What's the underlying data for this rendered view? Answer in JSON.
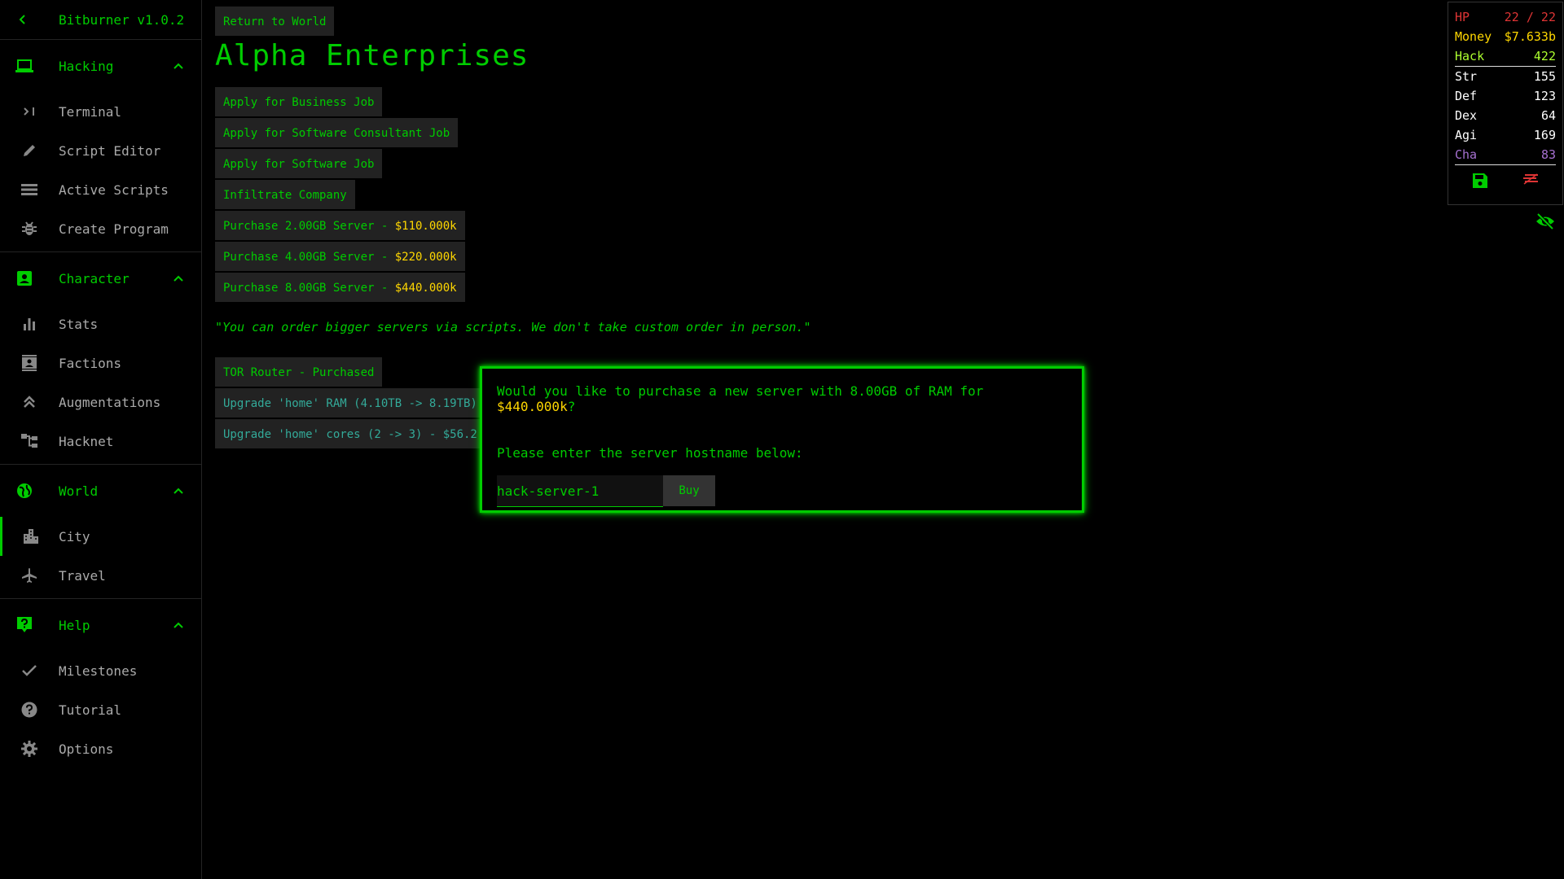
{
  "app": {
    "title": "Bitburner v1.0.2"
  },
  "sidebar": {
    "sections": [
      {
        "label": "Hacking",
        "items": [
          {
            "label": "Terminal",
            "icon": "terminal-icon"
          },
          {
            "label": "Script Editor",
            "icon": "pencil-icon"
          },
          {
            "label": "Active Scripts",
            "icon": "list-icon"
          },
          {
            "label": "Create Program",
            "icon": "bug-icon"
          }
        ]
      },
      {
        "label": "Character",
        "items": [
          {
            "label": "Stats",
            "icon": "bar-chart-icon"
          },
          {
            "label": "Factions",
            "icon": "contacts-icon"
          },
          {
            "label": "Augmentations",
            "icon": "double-chevron-up-icon"
          },
          {
            "label": "Hacknet",
            "icon": "tree-icon"
          }
        ]
      },
      {
        "label": "World",
        "items": [
          {
            "label": "City",
            "icon": "city-icon"
          },
          {
            "label": "Travel",
            "icon": "airplane-icon"
          }
        ]
      },
      {
        "label": "Help",
        "items": [
          {
            "label": "Milestones",
            "icon": "check-icon"
          },
          {
            "label": "Tutorial",
            "icon": "help-icon"
          },
          {
            "label": "Options",
            "icon": "gear-icon"
          }
        ]
      }
    ]
  },
  "main": {
    "return_label": "Return to World",
    "title": "Alpha Enterprises",
    "jobs": [
      "Apply for Business Job",
      "Apply for Software Consultant Job",
      "Apply for Software Job",
      "Infiltrate Company"
    ],
    "servers": [
      {
        "label": "Purchase 2.00GB Server - ",
        "price": "$110.000k"
      },
      {
        "label": "Purchase 4.00GB Server - ",
        "price": "$220.000k"
      },
      {
        "label": "Purchase 8.00GB Server - ",
        "price": "$440.000k"
      }
    ],
    "quote": "\"You can order bigger servers via scripts. We don't take custom order in person.\"",
    "tor": "TOR Router - Purchased",
    "upgrades": [
      "Upgrade 'home' RAM (4.10TB -> 8.19TB)",
      "Upgrade 'home' cores (2 -> 3) - $56.2"
    ]
  },
  "modal": {
    "question_prefix": "Would you like to purchase a new server with 8.00GB of RAM for ",
    "price": "$440.000k",
    "question_suffix": "?",
    "prompt": "Please enter the server hostname below:",
    "hostname_value": "hack-server-1",
    "buy_label": "Buy"
  },
  "overview": {
    "hp_label": "HP",
    "hp_value": "22 / 22",
    "money_label": "Money",
    "money_value": "$7.633b",
    "hack_label": "Hack",
    "hack_value": "422",
    "str_label": "Str",
    "str_value": "155",
    "def_label": "Def",
    "def_value": "123",
    "dex_label": "Dex",
    "dex_value": "64",
    "agi_label": "Agi",
    "agi_value": "169",
    "cha_label": "Cha",
    "cha_value": "83"
  },
  "colors": {
    "accent": "#00cc00",
    "money": "#ffd700",
    "hp": "#dd3434",
    "cha": "#a671d1",
    "text_dim": "#aaaaaa"
  }
}
